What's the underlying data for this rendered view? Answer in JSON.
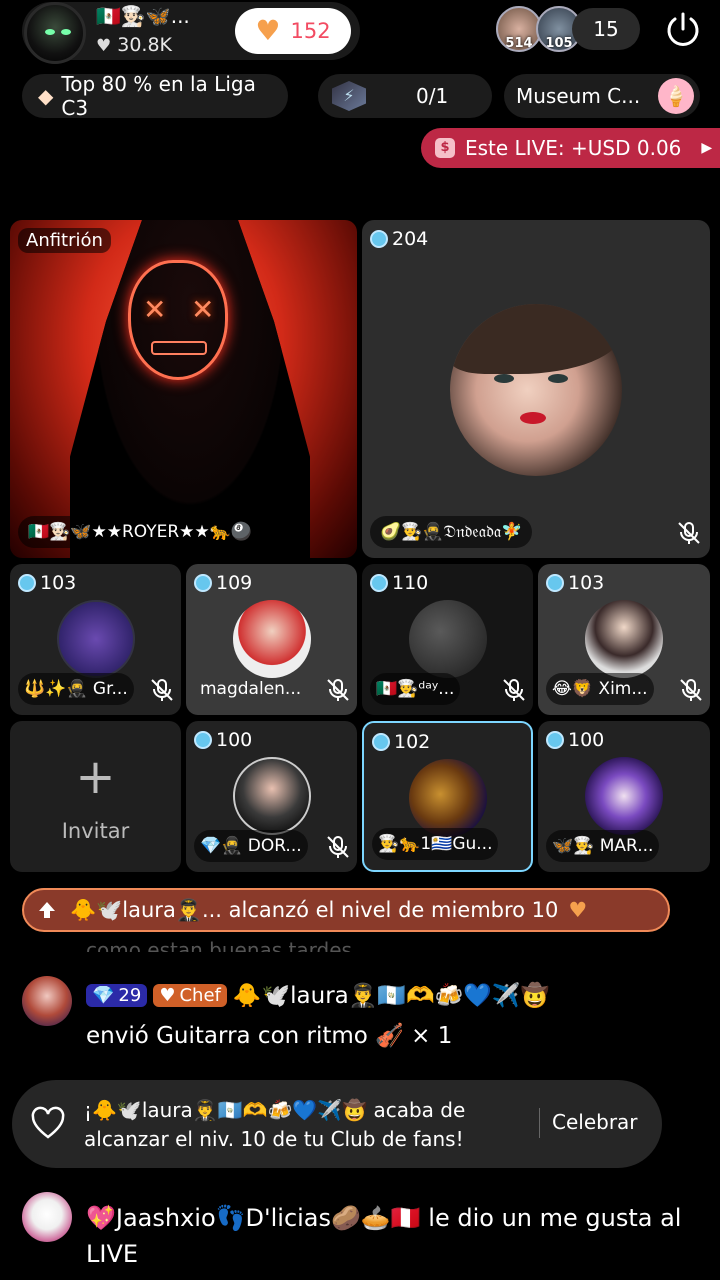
{
  "host": {
    "name_line": "🇲🇽👨🏻‍🍳🦋...",
    "likes": "30.8K",
    "fan_count": "152"
  },
  "viewers": {
    "avatars": [
      {
        "label": "514"
      },
      {
        "label": "105"
      }
    ],
    "count": "15"
  },
  "league": {
    "text": "Top 80 % en la Liga C3"
  },
  "match": {
    "value": "0/1"
  },
  "museum": {
    "text": "Museum C...",
    "icon": "🍦"
  },
  "live_earnings": {
    "text": "Este LIVE: +USD 0.06"
  },
  "grid": {
    "host_tile": {
      "label": "Anfitrión",
      "name": "🇲🇽👨🏻‍🍳🦋★★ROYER★★🐆🎱"
    },
    "big_guest": {
      "score": "204",
      "name": "🥑👨‍🍳🥷𝔇𝔫𝔡𝔢𝔞𝔡𝔞🧚"
    },
    "row1": [
      {
        "score": "103",
        "name": "🔱✨🥷 Gr..."
      },
      {
        "score": "109",
        "name": "magdalen..."
      },
      {
        "score": "110",
        "name": "🇲🇽👨‍🍳ᵈᵃʸ..."
      },
      {
        "score": "103",
        "name": "😂🦁 Xim..."
      }
    ],
    "invite_label": "Invitar",
    "row2": [
      {
        "score": "100",
        "name": "💎🥷 DOR..."
      },
      {
        "score": "102",
        "name": "👨‍🍳🐆1🇺🇾Gu..."
      },
      {
        "score": "100",
        "name": "🦋👨‍🍳 MAR..."
      }
    ]
  },
  "member_banner": {
    "text": "🐥🕊️laura👨‍✈️... alcanzó el nivel de miembro 10"
  },
  "faded_text": "como estan buenas tardes",
  "chat": {
    "level": "29",
    "role": "Chef",
    "user": "🐥🕊️laura👨‍✈️🇬🇹🫶🍻💙✈️🤠",
    "action": "envió Guitarra con ritmo",
    "gift_icon": "🎻",
    "count": "× 1"
  },
  "fans_card": {
    "text": "¡🐥🕊️laura👨‍✈️🇬🇹🫶🍻💙✈️🤠 acaba de alcanzar el niv. 10 de tu Club de fans!",
    "button": "Celebrar"
  },
  "like_line": {
    "text": "💖Jaashxio👣D'licias🥔🥧🇵🇪 le dio un me gusta al LIVE"
  },
  "colors": {
    "background": "#000000",
    "live_red": "#bd2845",
    "score_blue": "#67c7ee",
    "selected_border": "#7dd6ff",
    "banner_orange": "#f08a58"
  },
  "icons": [
    "power-icon",
    "mic-muted-icon",
    "heart-icon",
    "diamond-icon",
    "plus-icon",
    "arrow-up-icon"
  ]
}
